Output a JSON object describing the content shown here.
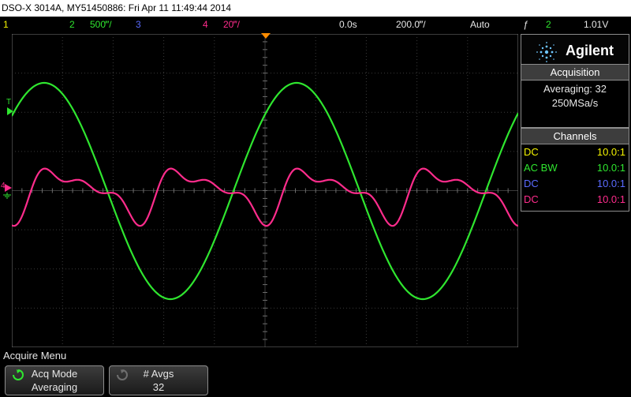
{
  "titlebar": {
    "text": "DSO-X 3014A, MY51450886: Fri Apr 11 11:49:44 2014"
  },
  "status": {
    "ch1_num": "1",
    "ch2_num": "2",
    "ch2_scale": "500‴/",
    "ch3_num": "3",
    "ch4_num": "4",
    "ch4_scale": "20‴/",
    "time_offset": "0.0s",
    "time_scale": "200.0‴/",
    "trigger_mode": "Auto",
    "trigger_symbol": "ƒ",
    "trigger_ch": "2",
    "trigger_level": "1.01V"
  },
  "markers": {
    "trigger_left": "T",
    "ch4": "4"
  },
  "panel": {
    "brand": "Agilent",
    "acquisition": {
      "header": "Acquisition",
      "mode": "Averaging: 32",
      "rate": "250MSa/s"
    },
    "channels": {
      "header": "Channels",
      "rows": [
        {
          "coupling": "DC",
          "probe": "10.0:1",
          "color": "#f4f400"
        },
        {
          "coupling": "AC BW",
          "probe": "10.0:1",
          "color": "#2fe62f"
        },
        {
          "coupling": "DC",
          "probe": "10.0:1",
          "color": "#5a6bff"
        },
        {
          "coupling": "DC",
          "probe": "10.0:1",
          "color": "#ff2c8c"
        }
      ]
    }
  },
  "menu": {
    "title": "Acquire Menu",
    "softkeys": [
      {
        "label": "Acq Mode",
        "value": "Averaging"
      },
      {
        "label": "# Avgs",
        "value": "32"
      }
    ]
  },
  "colors": {
    "ch1": "#f4f400",
    "ch2": "#2fe62f",
    "ch3": "#5a6bff",
    "ch4": "#ff2c8c",
    "trigger": "#ff8c00"
  },
  "traces": [
    {
      "name": "2",
      "shape": "sine",
      "periods_visible": 2.0
    },
    {
      "name": "4",
      "shape": "distorted-sine",
      "periods_visible": 4.0
    }
  ]
}
